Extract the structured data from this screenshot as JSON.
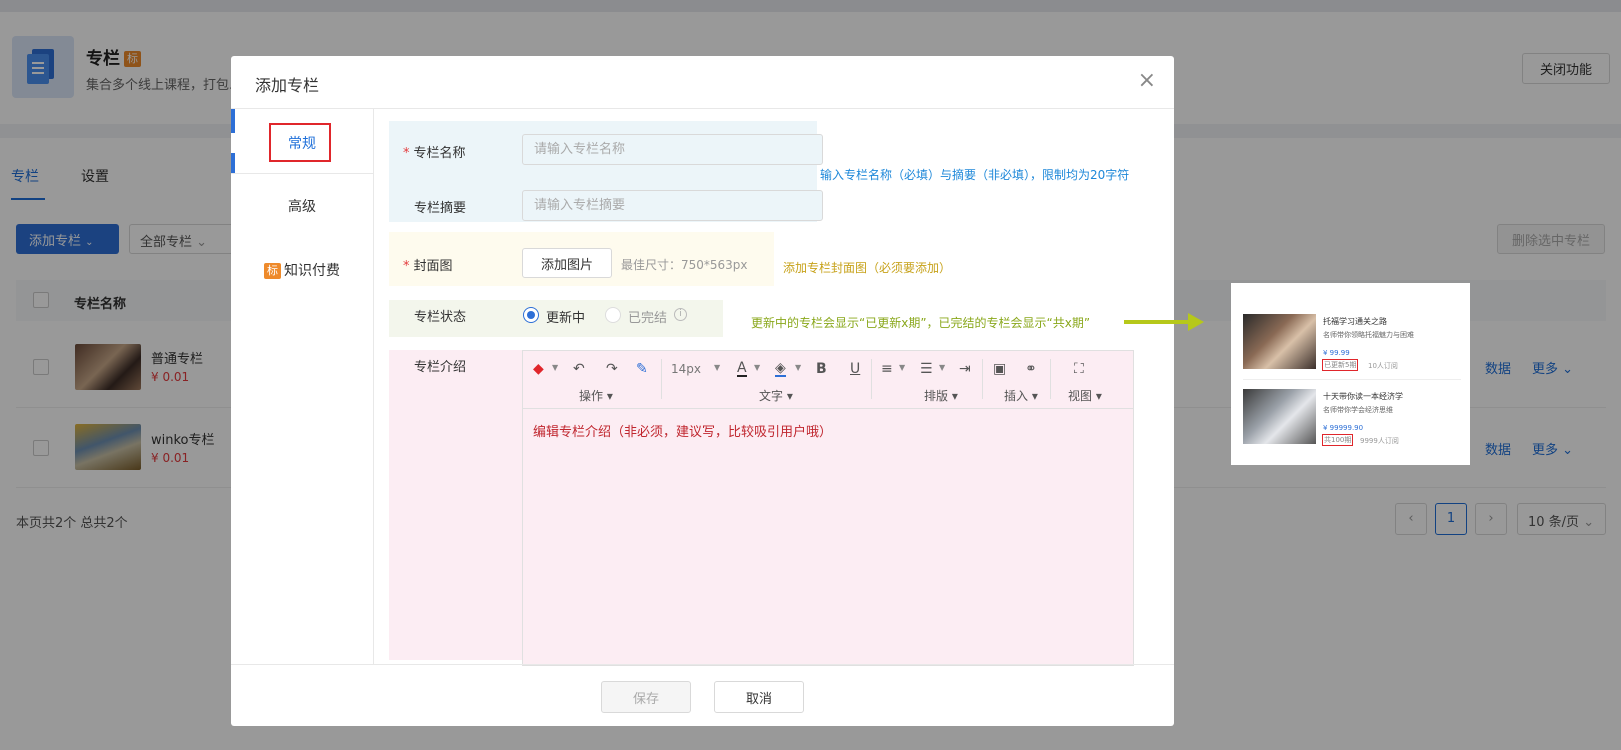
{
  "background": {
    "app": {
      "title": "专栏",
      "tag": "标",
      "description": "集合多个线上课程，打包...",
      "close_feature": "关闭功能"
    },
    "tabs": [
      {
        "label": "专栏"
      },
      {
        "label": "设置"
      }
    ],
    "toolbar": {
      "add_column": "添加专栏",
      "filter": "全部专栏",
      "delete_selected": "删除选中专栏"
    },
    "table": {
      "header_name": "专栏名称",
      "rows": [
        {
          "name": "普通专栏",
          "price": "¥ 0.01",
          "data_link": "数据",
          "more_link": "更多"
        },
        {
          "name": "winko专栏",
          "price": "¥ 0.01",
          "data_link": "数据",
          "more_link": "更多"
        }
      ]
    },
    "pagination": {
      "summary": "本页共2个 总共2个",
      "current_page": "1",
      "page_size": "10 条/页",
      "prev": "‹",
      "next": "›"
    }
  },
  "modal": {
    "title": "添加专栏",
    "close_icon": "×",
    "sidebar": {
      "items": [
        {
          "label": "常规"
        },
        {
          "label": "高级"
        },
        {
          "label": "知识付费",
          "tag": "标"
        }
      ]
    },
    "form": {
      "name": {
        "label": "专栏名称",
        "required_mark": "*",
        "placeholder": "请输入专栏名称"
      },
      "summary": {
        "label": "专栏摘要",
        "placeholder": "请输入专栏摘要"
      },
      "cover": {
        "label": "封面图",
        "required_mark": "*",
        "button": "添加图片",
        "hint": "最佳尺寸：750*563px"
      },
      "status": {
        "label": "专栏状态",
        "options": [
          {
            "label": "更新中",
            "checked": true
          },
          {
            "label": "已完结",
            "checked": false
          }
        ]
      },
      "intro": {
        "label": "专栏介绍",
        "toolbar": {
          "font_size": "14px",
          "groups": [
            "操作",
            "文字",
            "排版",
            "插入",
            "视图"
          ]
        },
        "content": "编辑专栏介绍（非必须，建议写，比较吸引用户哦）"
      }
    },
    "footer": {
      "save": "保存",
      "cancel": "取消"
    }
  },
  "annotations": {
    "name_summary": "输入专栏名称（必填）与摘要（非必填），限制均为20字符",
    "cover": "添加专栏封面图（必须要添加）",
    "status": "更新中的专栏会显示“已更新x期”，已完结的专栏会显示“共x期”"
  },
  "preview": {
    "cards": [
      {
        "title": "托福学习通关之路",
        "subtitle": "名师带你领略托福魅力与困难",
        "price": "¥ 99.99",
        "badge": "已更新5期",
        "subscribers": "10人订阅"
      },
      {
        "title": "十天带你读一本经济学",
        "subtitle": "名师带你学会经济思维",
        "price": "¥ 99999.90",
        "badge": "共100期",
        "subscribers": "9999人订阅"
      }
    ]
  },
  "colors": {
    "accent": "#2d6fd6",
    "price_red": "#e4393c",
    "tag_orange": "#ee8a2b",
    "annotation_blue": "#1e88d9",
    "annotation_yellow": "#c7a21a",
    "annotation_green": "#8aa81c"
  }
}
